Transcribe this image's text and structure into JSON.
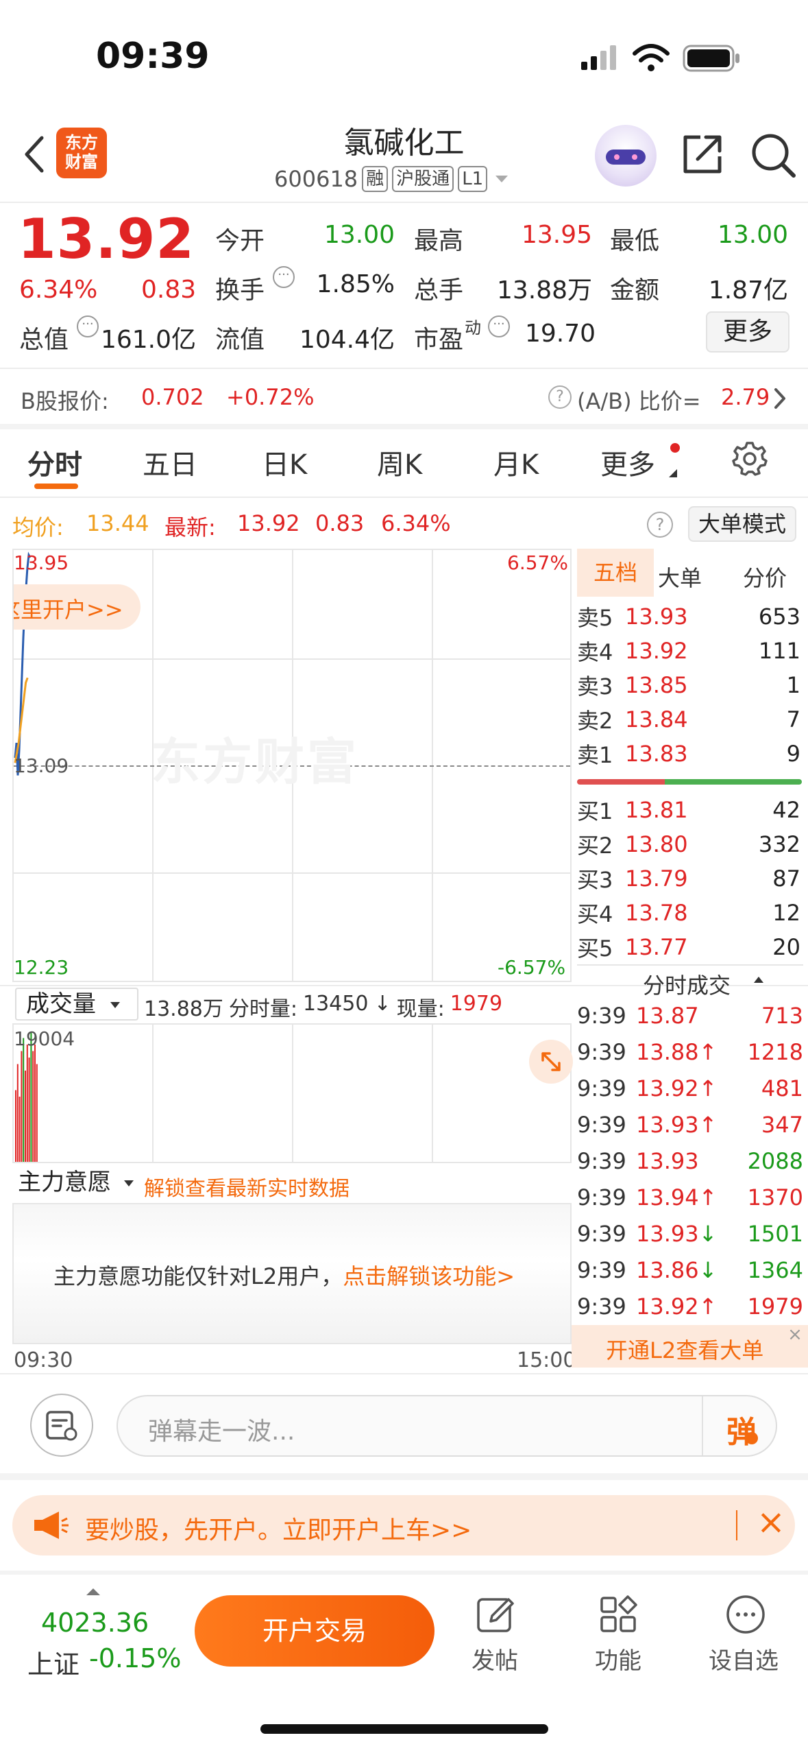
{
  "status_bar": {
    "time": "09:39"
  },
  "header": {
    "logo_text_line1": "东方",
    "logo_text_line2": "财富",
    "title": "氯碱化工",
    "code": "600618",
    "tags": [
      "融",
      "沪股通",
      "L1"
    ]
  },
  "quote": {
    "price": "13.92",
    "change_pct": "6.34%",
    "change": "0.83",
    "stats": [
      {
        "label": "今开",
        "value": "13.00",
        "color": "green"
      },
      {
        "label": "最高",
        "value": "13.95",
        "color": "red"
      },
      {
        "label": "最低",
        "value": "13.00",
        "color": "green"
      },
      {
        "label": "换手",
        "value": "1.85%",
        "color": "dark"
      },
      {
        "label": "总手",
        "value": "13.88万",
        "color": "dark"
      },
      {
        "label": "金额",
        "value": "1.87亿",
        "color": "dark"
      },
      {
        "label": "总值",
        "value": "161.0亿",
        "color": "dark"
      },
      {
        "label": "流值",
        "value": "104.4亿",
        "color": "dark"
      },
      {
        "label": "市盈",
        "value": "19.70",
        "color": "dark"
      }
    ],
    "pe_superscript": "动",
    "more_button": "更多"
  },
  "b_share": {
    "label": "B股报价:",
    "price": "0.702",
    "change": "+0.72%",
    "ratio_label": "(A/B) 比价=",
    "ratio_value": "2.79"
  },
  "tabs": [
    "分时",
    "五日",
    "日K",
    "周K",
    "月K",
    "更多"
  ],
  "chart_info": {
    "avg_label": "均价:",
    "avg_value": "13.44",
    "latest_label": "最新:",
    "latest_value": "13.92",
    "latest_change": "0.83",
    "latest_pct": "6.34%",
    "big_order_mode": "大单模式"
  },
  "chart": {
    "high_label": "13.95",
    "mid_label": "13.09",
    "low_label": "12.23",
    "high_pct": "6.57%",
    "low_pct": "-6.57%",
    "banner": "这里开户>>",
    "watermark": "东方财富",
    "time_start": "09:30",
    "time_end": "15:00"
  },
  "chart_data": {
    "type": "line",
    "title": "",
    "ylim": [
      12.23,
      13.95
    ],
    "x_range": [
      "09:30",
      "15:00"
    ],
    "series": [
      {
        "name": "",
        "values": [
          13.12,
          13.18,
          13.05,
          13.15,
          13.3,
          13.45,
          13.6,
          13.72,
          13.8,
          13.88,
          13.93,
          13.92
        ]
      },
      {
        "name": "",
        "values": [
          13.1,
          13.14,
          13.18,
          13.24,
          13.3,
          13.36,
          13.42,
          13.44
        ]
      }
    ],
    "volume": {
      "max_label": "19004"
    }
  },
  "volume_bar": {
    "dropdown": "成交量",
    "total": "13.88万",
    "period_label": "分时量:",
    "period_value": "13450",
    "arrow": "↓",
    "current_label": "现量:",
    "current_value": "1979"
  },
  "main_force": {
    "dropdown": "主力意愿",
    "unlock_text": "解锁查看最新实时数据",
    "notice": "主力意愿功能仅针对L2用户，",
    "notice_link": "点击解锁该功能>"
  },
  "order_book": {
    "tabs": [
      "五档",
      "大单",
      "分价"
    ],
    "sell": [
      {
        "label": "卖5",
        "price": "13.93",
        "vol": "653"
      },
      {
        "label": "卖4",
        "price": "13.92",
        "vol": "111"
      },
      {
        "label": "卖3",
        "price": "13.85",
        "vol": "1"
      },
      {
        "label": "卖2",
        "price": "13.84",
        "vol": "7"
      },
      {
        "label": "卖1",
        "price": "13.83",
        "vol": "9"
      }
    ],
    "buy": [
      {
        "label": "买1",
        "price": "13.81",
        "vol": "42"
      },
      {
        "label": "买2",
        "price": "13.80",
        "vol": "332"
      },
      {
        "label": "买3",
        "price": "13.79",
        "vol": "87"
      },
      {
        "label": "买4",
        "price": "13.78",
        "vol": "12"
      },
      {
        "label": "买5",
        "price": "13.77",
        "vol": "20"
      }
    ],
    "trades_title": "分时成交",
    "trades": [
      {
        "time": "9:39",
        "price": "13.87",
        "arrow": "",
        "vol": "713",
        "vcolor": "red"
      },
      {
        "time": "9:39",
        "price": "13.88",
        "arrow": "↑",
        "vol": "1218",
        "vcolor": "red"
      },
      {
        "time": "9:39",
        "price": "13.92",
        "arrow": "↑",
        "vol": "481",
        "vcolor": "red"
      },
      {
        "time": "9:39",
        "price": "13.93",
        "arrow": "↑",
        "vol": "347",
        "vcolor": "red"
      },
      {
        "time": "9:39",
        "price": "13.93",
        "arrow": "",
        "vol": "2088",
        "vcolor": "green"
      },
      {
        "time": "9:39",
        "price": "13.94",
        "arrow": "↑",
        "vol": "1370",
        "vcolor": "red"
      },
      {
        "time": "9:39",
        "price": "13.93",
        "arrow": "↓",
        "vol": "1501",
        "vcolor": "green"
      },
      {
        "time": "9:39",
        "price": "13.86",
        "arrow": "↓",
        "vol": "1364",
        "vcolor": "green"
      },
      {
        "time": "9:39",
        "price": "13.92",
        "arrow": "↑",
        "vol": "1979",
        "vcolor": "red"
      }
    ],
    "l2_promo": "开通L2查看大单"
  },
  "danmaku": {
    "placeholder": "弹幕走一波...",
    "send_icon_text": "弹"
  },
  "promo_bar": {
    "text": "要炒股，先开户。立即开户上车>>"
  },
  "bottom_bar": {
    "index_value": "4023.36",
    "index_name": "上证",
    "index_change": "-0.15%",
    "trade_button": "开户交易",
    "items": [
      "发帖",
      "功能",
      "设自选"
    ]
  }
}
